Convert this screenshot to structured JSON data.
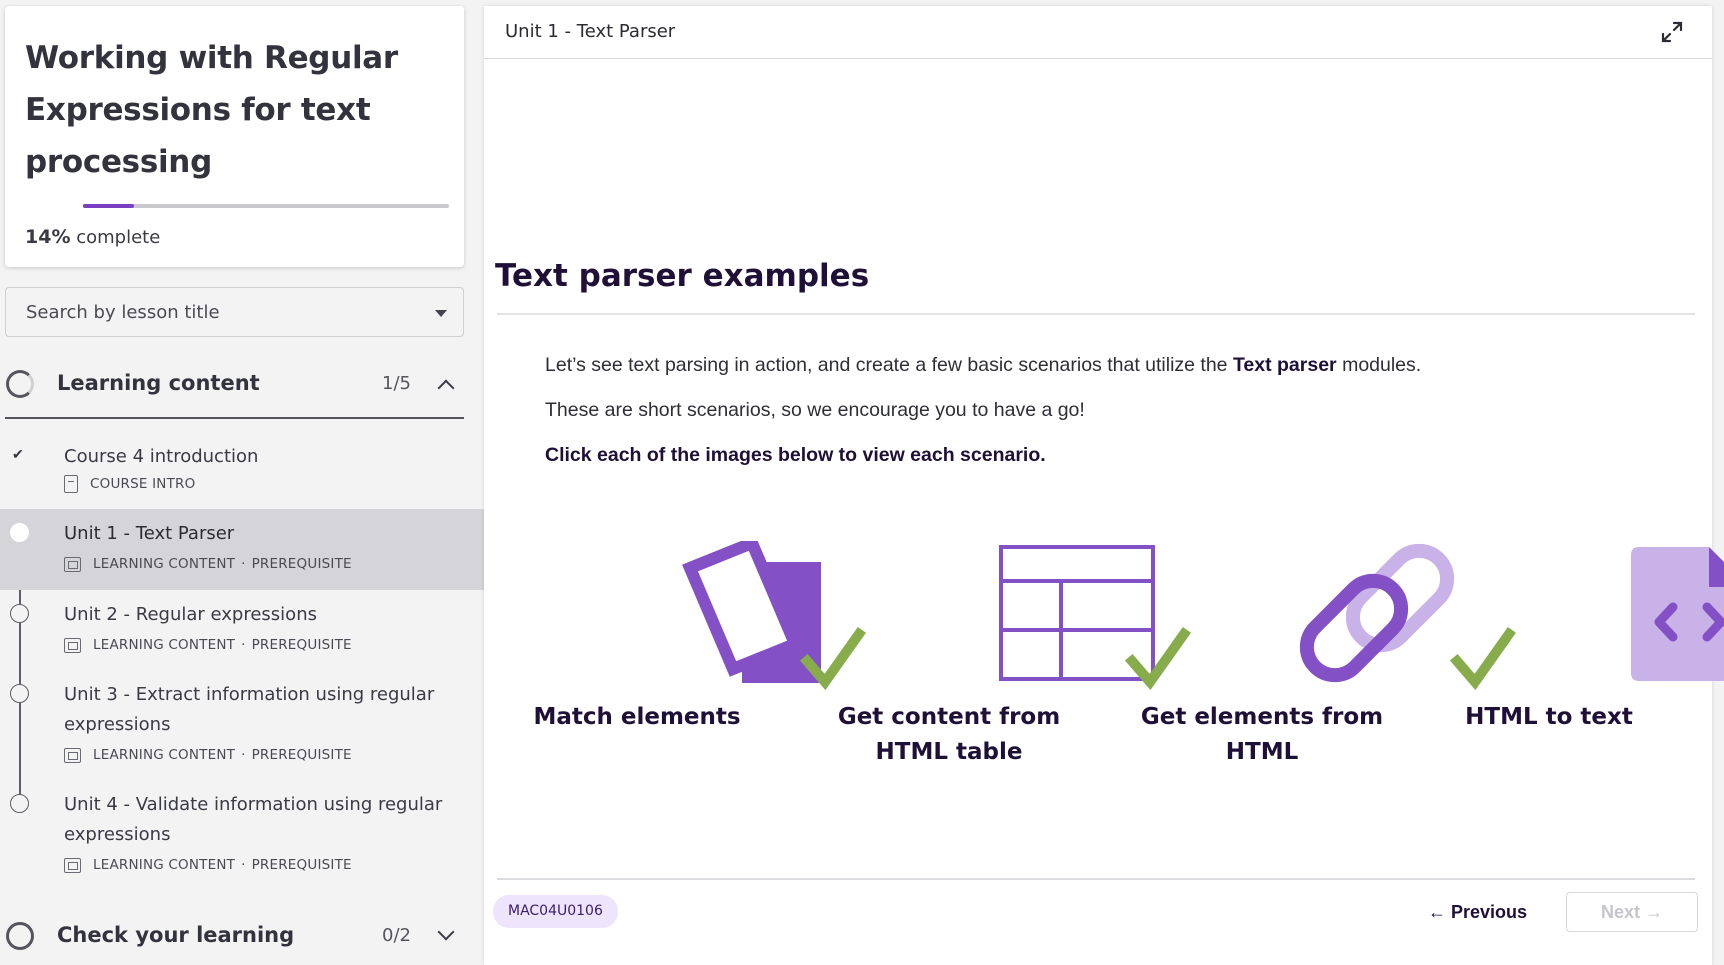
{
  "course": {
    "title": "Working with Regular Expressions for text processing",
    "progress_percent": 14,
    "progress_value": "14%",
    "progress_suffix": "complete"
  },
  "search": {
    "placeholder": "Search by lesson title"
  },
  "sections": [
    {
      "label": "Learning content",
      "count": "1/5",
      "expanded": true
    },
    {
      "label": "Check your learning",
      "count": "0/2",
      "expanded": false
    }
  ],
  "lessons": [
    {
      "title": "Course 4 introduction",
      "type": "COURSE INTRO",
      "tag": "",
      "status": "complete",
      "active": false
    },
    {
      "title": "Unit 1 - Text Parser",
      "type": "LEARNING CONTENT",
      "tag": "PREREQUISITE",
      "status": "current",
      "active": true
    },
    {
      "title": "Unit 2 - Regular expressions",
      "type": "LEARNING CONTENT",
      "tag": "PREREQUISITE",
      "status": "not-started",
      "active": false
    },
    {
      "title": "Unit 3 - Extract information using regular expressions",
      "type": "LEARNING CONTENT",
      "tag": "PREREQUISITE",
      "status": "not-started",
      "active": false
    },
    {
      "title": "Unit 4 - Validate information using regular expressions",
      "type": "LEARNING CONTENT",
      "tag": "PREREQUISITE",
      "status": "not-started",
      "active": false
    }
  ],
  "meta_separator": "·",
  "main": {
    "header_title": "Unit 1 - Text Parser",
    "page_title": "Text parser examples",
    "paragraph1_pre": "Let’s see text parsing in action, and create a few basic scenarios that utilize the ",
    "paragraph1_bold": "Text parser",
    "paragraph1_post": " modules.",
    "paragraph2": "These are short scenarios, so we encourage you to have a go!",
    "paragraph3": "Click each of the images below to view each scenario.",
    "cards": [
      {
        "label": "Match elements",
        "icon": "match-elements-icon",
        "checked": true
      },
      {
        "label": "Get content from HTML table",
        "icon": "html-table-icon",
        "checked": true
      },
      {
        "label": "Get elements from HTML",
        "icon": "link-icon",
        "checked": true
      },
      {
        "label": "HTML to text",
        "icon": "code-file-icon",
        "checked": false
      }
    ],
    "unit_code": "MAC04U0106",
    "previous_label": "Previous",
    "next_label": "Next"
  },
  "colors": {
    "accent_purple": "#7a3fc1",
    "icon_purple": "#8450c6",
    "icon_light_purple": "#c9b2e8",
    "check_green": "#86ac4c",
    "heading_dark": "#1e1036"
  }
}
